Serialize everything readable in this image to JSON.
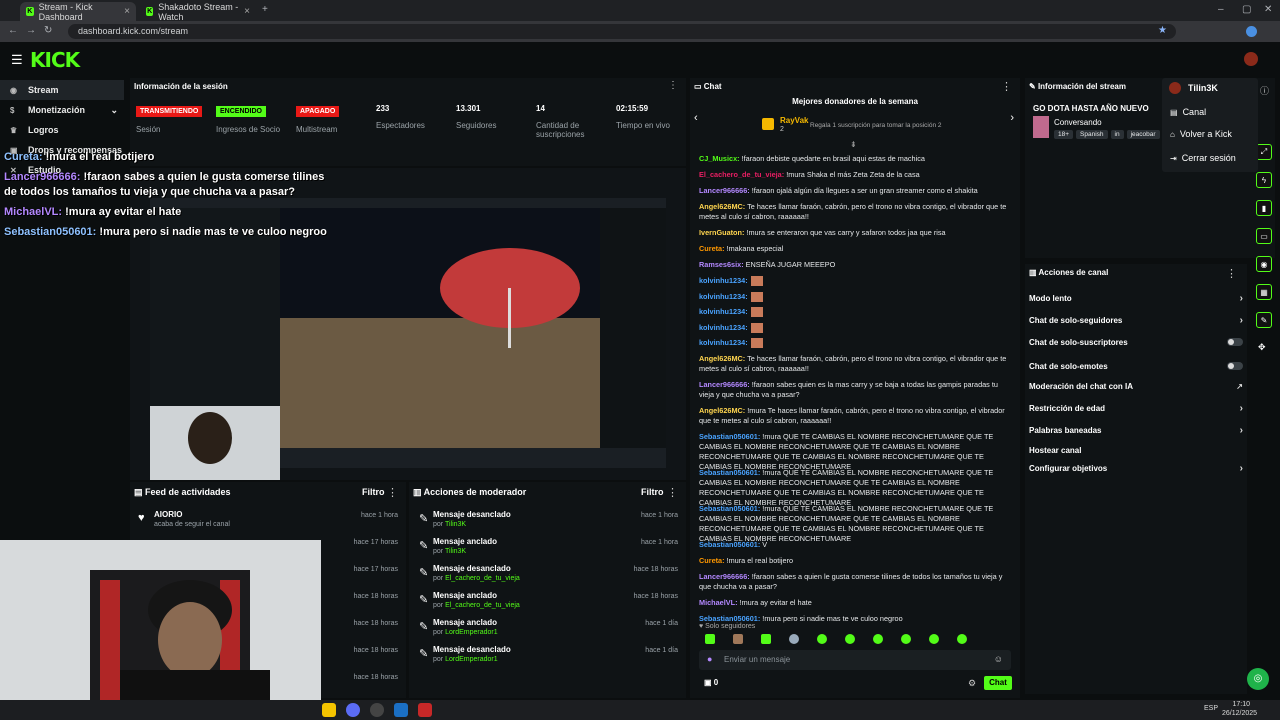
{
  "browser": {
    "tabs": [
      {
        "title": "Stream - Kick Dashboard",
        "active": true
      },
      {
        "title": "Shakadoto Stream - Watch",
        "active": false
      }
    ],
    "url": "dashboard.kick.com/stream"
  },
  "brand": {
    "logo": "KICK",
    "accent": "#53fc18"
  },
  "sidebar": {
    "items": [
      {
        "label": "Stream",
        "icon": "broadcast-icon",
        "active": true
      },
      {
        "label": "Monetización",
        "icon": "money-icon"
      },
      {
        "label": "Logros",
        "icon": "trophy-icon"
      },
      {
        "label": "Drops y recompensas",
        "icon": "gift-icon"
      },
      {
        "label": "Estudio",
        "icon": "studio-icon"
      }
    ]
  },
  "stream_info_header": {
    "title": "Información de la sesión",
    "metrics": [
      {
        "value": "TRANSMITIENDO",
        "label": "Sesión",
        "type": "pill",
        "color": "#e91916"
      },
      {
        "value": "ENCENDIDO",
        "label": "Ingresos de Socio",
        "type": "pill",
        "color": "#53fc18"
      },
      {
        "value": "APAGADO",
        "label": "Multistream",
        "type": "pill",
        "color": "#e91916"
      },
      {
        "value": "233",
        "label": "Espectadores",
        "type": "text"
      },
      {
        "value": "13.301",
        "label": "Seguidores",
        "type": "text"
      },
      {
        "value": "14",
        "label": "Cantidad de suscripciones",
        "type": "text"
      },
      {
        "value": "02:15:59",
        "label": "Tiempo en vivo",
        "type": "text"
      }
    ]
  },
  "overlay_chat": [
    {
      "user": "Cureta:",
      "text": " !mura el real botijero",
      "color": "#8ec1ff"
    },
    {
      "user": "Lancer966666:",
      "text": " !faraon sabes a quien le gusta comerse tilines",
      "color": "#b388ff"
    },
    {
      "user": "",
      "text": "de todos los tamaños tu vieja y que chucha va a pasar?",
      "color": "#fff"
    },
    {
      "user": "MichaelVL:",
      "text": " !mura ay evitar el hate",
      "color": "#b388ff"
    },
    {
      "user": "Sebastian050601:",
      "text": " !mura pero si nadie mas te ve culoo negroo",
      "color": "#8ec1ff"
    }
  ],
  "activity_feed": {
    "title": "Feed de actividades",
    "filter": "Filtro",
    "items": [
      {
        "name": "AIORIO",
        "sub": "acaba de seguir el canal",
        "time": "hace 1 hora"
      },
      {
        "name": "",
        "sub": "",
        "time": "hace 17 horas"
      },
      {
        "name": "",
        "sub": "",
        "time": "hace 17 horas"
      },
      {
        "name": "",
        "sub": "",
        "time": "hace 18 horas"
      },
      {
        "name": "",
        "sub": "",
        "time": "hace 18 horas"
      },
      {
        "name": "",
        "sub": "",
        "time": "hace 18 horas"
      },
      {
        "name": "",
        "sub": "",
        "time": "hace 18 horas"
      }
    ]
  },
  "mod_actions": {
    "title": "Acciones de moderador",
    "filter": "Filtro",
    "items": [
      {
        "action": "Mensaje desanclado",
        "by": "por",
        "user": "Tilin3K",
        "time": "hace 1 hora"
      },
      {
        "action": "Mensaje anclado",
        "by": "por",
        "user": "Tilin3K",
        "time": "hace 1 hora"
      },
      {
        "action": "Mensaje desanclado",
        "by": "por",
        "user": "El_cachero_de_tu_vieja",
        "time": "hace 18 horas"
      },
      {
        "action": "Mensaje anclado",
        "by": "por",
        "user": "El_cachero_de_tu_vieja",
        "time": "hace 18 horas"
      },
      {
        "action": "Mensaje anclado",
        "by": "por",
        "user": "LordEmperador1",
        "time": "hace 1 día"
      },
      {
        "action": "Mensaje desanclado",
        "by": "por",
        "user": "LordEmperador1",
        "time": "hace 1 día"
      }
    ]
  },
  "chat": {
    "title": "Chat",
    "donors_title": "Mejores donadores de la semana",
    "donor_name": "RayVak",
    "donor_count": "2",
    "donor_hint": "Regala 1 suscripción para tomar la posición 2",
    "messages": [
      {
        "user": "CJ_Musicx:",
        "text": " !faraon debiste quedarte en brasil aqui estas de machica",
        "color": "#53fc18"
      },
      {
        "user": "El_cachero_de_tu_vieja:",
        "text": " !mura Shaka el más Zeta Zeta de la casa",
        "color": "#e91e63"
      },
      {
        "user": "Lancer966666:",
        "text": " !faraon ojalá algún día llegues a ser un gran streamer como el shakita",
        "color": "#b388ff"
      },
      {
        "user": "Angel626MC:",
        "text": " Te haces llamar faraón, cabrón, pero el trono no vibra contigo, el vibrador que te metes al culo sí cabron, raaaaaa!!",
        "color": "#ffd54f"
      },
      {
        "user": "IvernGuaton:",
        "text": " !mura se enteraron que vas carry y safaron todos jaa que risa",
        "color": "#ffd54f"
      },
      {
        "user": "Cureta:",
        "text": " !makana especial",
        "color": "#ff9800"
      },
      {
        "user": "Ramses6six:",
        "text": " ENSEÑA JUGAR MEEEPO",
        "color": "#b388ff"
      },
      {
        "user": "kolvinhu1234:",
        "text": "",
        "color": "#4aa3ff"
      },
      {
        "user": "kolvinhu1234:",
        "text": "",
        "color": "#4aa3ff"
      },
      {
        "user": "kolvinhu1234:",
        "text": "",
        "color": "#4aa3ff"
      },
      {
        "user": "kolvinhu1234:",
        "text": "",
        "color": "#4aa3ff"
      },
      {
        "user": "kolvinhu1234:",
        "text": "",
        "color": "#4aa3ff"
      },
      {
        "user": "Angel626MC:",
        "text": " Te haces llamar faraón, cabrón, pero el trono no vibra contigo, el vibrador que te metes al culo sí cabron, raaaaaa!!",
        "color": "#ffd54f"
      },
      {
        "user": "Lancer966666:",
        "text": " !faraon sabes quien es la mas carry y se baja a todas las gampis paradas tu vieja y que chucha va a pasar?",
        "color": "#b388ff"
      },
      {
        "user": "Angel626MC:",
        "text": " !mura Te haces llamar faraón, cabrón, pero el trono no vibra contigo, el vibrador que te metes al culo sí cabron, raaaaaa!!",
        "color": "#ffd54f"
      },
      {
        "user": "Sebastian050601:",
        "text": " !mura QUE TE CAMBIAS EL NOMBRE RECONCHETUMARE QUE TE CAMBIAS EL NOMBRE RECONCHETUMARE QUE TE CAMBIAS EL NOMBRE RECONCHETUMARE QUE TE CAMBIAS EL NOMBRE RECONCHETUMARE QUE TE CAMBIAS EL NOMBRE RECONCHETUMARE",
        "color": "#4aa3ff"
      },
      {
        "user": "Sebastian050601:",
        "text": " !mura QUE TE CAMBIAS EL NOMBRE RECONCHETUMARE QUE TE CAMBIAS EL NOMBRE RECONCHETUMARE QUE TE CAMBIAS EL NOMBRE RECONCHETUMARE QUE TE CAMBIAS EL NOMBRE RECONCHETUMARE QUE TE CAMBIAS EL NOMBRE RECONCHETUMARE",
        "color": "#4aa3ff"
      },
      {
        "user": "Sebastian050601:",
        "text": " !mura QUE TE CAMBIAS EL NOMBRE RECONCHETUMARE QUE TE CAMBIAS EL NOMBRE RECONCHETUMARE QUE TE CAMBIAS EL NOMBRE RECONCHETUMARE QUE TE CAMBIAS EL NOMBRE RECONCHETUMARE QUE TE CAMBIAS EL NOMBRE RECONCHETUMARE",
        "color": "#4aa3ff"
      },
      {
        "user": "Sebastian050601:",
        "text": " V",
        "color": "#4aa3ff"
      },
      {
        "user": "Cureta:",
        "text": " !mura el real botijero",
        "color": "#ff9800"
      },
      {
        "user": "Lancer966666:",
        "text": " !faraon sabes a quien le gusta comerse tilines de todos los tamaños tu vieja y que chucha va a pasar?",
        "color": "#b388ff"
      },
      {
        "user": "MichaelVL:",
        "text": " !mura ay evitar el hate",
        "color": "#b388ff"
      },
      {
        "user": "Sebastian050601:",
        "text": " !mura pero si nadie mas te ve culoo negroo",
        "color": "#4aa3ff"
      }
    ],
    "followers_only": "Solo seguidores",
    "input_placeholder": "Enviar un mensaje",
    "points": "0",
    "send_label": "Chat"
  },
  "stream_panel": {
    "title": "Información del stream",
    "stream_title": "GO DOTA HASTA AÑO NUEVO",
    "category": "Conversando",
    "tags": [
      "18+",
      "Spanish",
      "in",
      "jeacobar"
    ]
  },
  "channel_actions": {
    "title": "Acciones de canal",
    "items": [
      {
        "label": "Modo lento",
        "kind": "arrow"
      },
      {
        "label": "Chat de solo-seguidores",
        "kind": "arrow"
      },
      {
        "label": "Chat de solo-suscriptores",
        "kind": "toggle"
      },
      {
        "label": "Chat de solo-emotes",
        "kind": "toggle"
      },
      {
        "label": "Moderación del chat con IA",
        "kind": "external"
      },
      {
        "label": "Restricción de edad",
        "kind": "arrow"
      },
      {
        "label": "Palabras baneadas",
        "kind": "arrow"
      },
      {
        "label": "Hostear canal",
        "kind": "none"
      },
      {
        "label": "Configurar objetivos",
        "kind": "arrow"
      }
    ]
  },
  "user_menu": {
    "username": "Tilin3K",
    "items": [
      "Canal",
      "Volver a Kick",
      "Cerrar sesión"
    ]
  },
  "taskbar": {
    "lang": "ESP",
    "time": "17:10",
    "date": "26/12/2025"
  }
}
